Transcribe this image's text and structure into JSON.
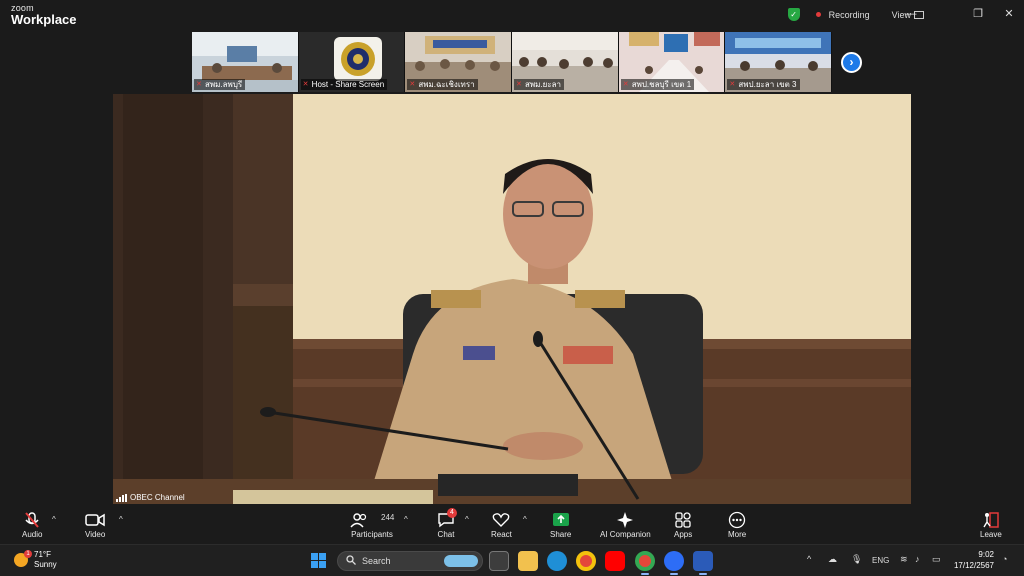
{
  "titlebar": {
    "brand_top": "zoom",
    "brand_bottom": "Workplace",
    "recording_label": "Recording",
    "view_label": "View",
    "minimize": "—",
    "restore": "❐",
    "close": "✕"
  },
  "thumbnails": [
    {
      "label": "สพม.ลพบุรี"
    },
    {
      "label": "Host - Share Screen"
    },
    {
      "label": "สพม.ฉะเชิงเทรา"
    },
    {
      "label": "สพม.ยะลา"
    },
    {
      "label": "สพป.ชลบุรี เขต 1"
    },
    {
      "label": "สพป.ยะลา เขต 3"
    }
  ],
  "main_video": {
    "participant_label": "OBEC Channel"
  },
  "toolbar": {
    "audio": "Audio",
    "video": "Video",
    "participants": "Participants",
    "participants_count": "244",
    "chat": "Chat",
    "chat_badge": "4",
    "react": "React",
    "share": "Share",
    "ai_companion": "AI Companion",
    "apps": "Apps",
    "more": "More",
    "leave": "Leave"
  },
  "taskbar": {
    "weather_temp": "71°F",
    "weather_desc": "Sunny",
    "weather_badge": "1",
    "search_placeholder": "Search",
    "language": "ENG",
    "time": "9:02",
    "date": "17/12/2567"
  },
  "colors": {
    "accent_blue": "#1e7ae8",
    "share_green": "#1aa34a",
    "recording_red": "#e23b3b",
    "shield_green": "#27a843"
  }
}
